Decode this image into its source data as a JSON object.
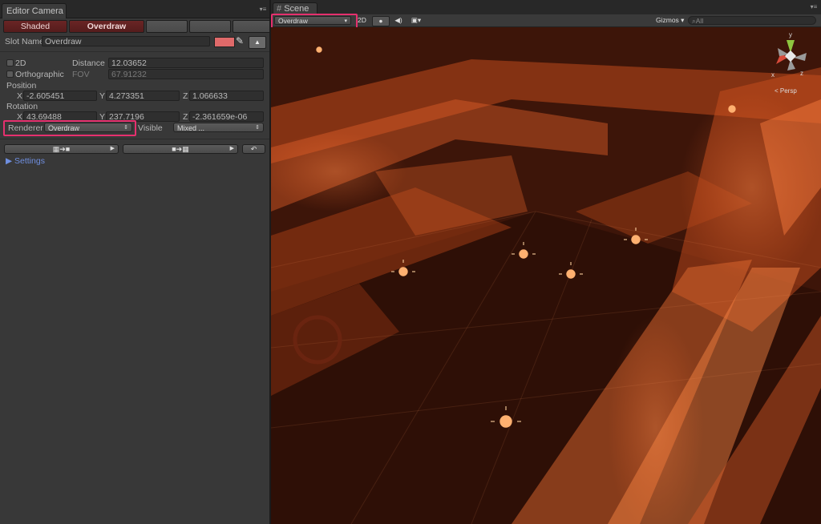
{
  "left_panel": {
    "tab_title": "Editor Camera",
    "mode_buttons": {
      "shaded": "Shaded",
      "overdraw": "Overdraw"
    },
    "slot_name": {
      "label": "Slot Name",
      "value": "Overdraw",
      "swatch_color": "#e06a6a"
    },
    "two_d": {
      "label": "2D"
    },
    "orthographic": {
      "label": "Orthographic"
    },
    "distance": {
      "label": "Distance",
      "value": "12.03652"
    },
    "fov": {
      "label": "FOV",
      "value": "67.91232"
    },
    "position": {
      "label": "Position",
      "x": "-2.605451",
      "y": "4.273351",
      "z": "1.066633"
    },
    "rotation": {
      "label": "Rotation",
      "x": "43.69488",
      "y": "237.7196",
      "z": "-2.361659e-06"
    },
    "axis": {
      "x": "X",
      "y": "Y",
      "z": "Z"
    },
    "renderer": {
      "label": "Renderer",
      "value": "Overdraw"
    },
    "visible": {
      "label": "Visible",
      "value": "Mixed ..."
    },
    "settings_label": "Settings"
  },
  "scene": {
    "tab_title": "Scene",
    "draw_mode": "Overdraw",
    "twod_label": "2D",
    "gizmos_label": "Gizmos",
    "search_placeholder": "All",
    "persp_label": "< Persp",
    "gizmo_axes": {
      "x": "x",
      "y": "y",
      "z": "z"
    }
  },
  "colors": {
    "highlight": "#e5306e",
    "overdraw_glow": "#ff7a3a",
    "link_blue": "#6f8fe0"
  }
}
